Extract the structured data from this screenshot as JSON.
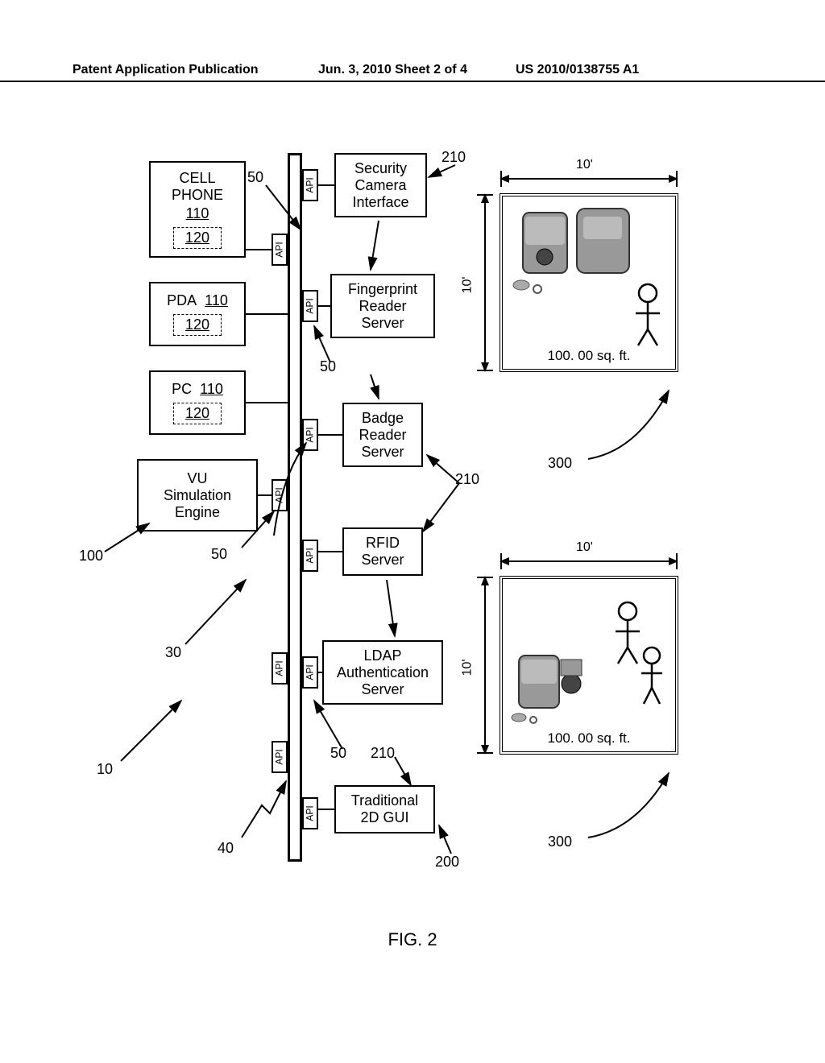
{
  "header": {
    "left": "Patent Application Publication",
    "center": "Jun. 3, 2010  Sheet 2 of 4",
    "right": "US 2010/0138755 A1"
  },
  "figure_label": "FIG. 2",
  "left_column": {
    "cellphone": {
      "line1": "CELL",
      "line2": "PHONE",
      "ref": "110",
      "sub": "120"
    },
    "pda": {
      "label": "PDA",
      "ref": "110",
      "sub": "120"
    },
    "pc": {
      "label": "PC",
      "ref": "110",
      "sub": "120"
    },
    "vu": {
      "line1": "VU",
      "line2": "Simulation",
      "line3": "Engine"
    }
  },
  "api_label": "API",
  "right_column": {
    "security": {
      "line1": "Security",
      "line2": "Camera",
      "line3": "Interface"
    },
    "fingerprint": {
      "line1": "Fingerprint",
      "line2": "Reader",
      "line3": "Server"
    },
    "badge": {
      "line1": "Badge",
      "line2": "Reader",
      "line3": "Server"
    },
    "rfid": {
      "line1": "RFID",
      "line2": "Server"
    },
    "ldap": {
      "line1": "LDAP",
      "line2": "Authentication",
      "line3": "Server"
    },
    "gui": {
      "line1": "Traditional",
      "line2": "2D GUI"
    }
  },
  "refs": {
    "r10": "10",
    "r30": "30",
    "r40": "40",
    "r50_a": "50",
    "r50_b": "50",
    "r50_c": "50",
    "r50_d": "50",
    "r100": "100",
    "r200": "200",
    "r210_a": "210",
    "r210_b": "210",
    "r210_c": "210",
    "r300_a": "300",
    "r300_b": "300"
  },
  "room": {
    "dim_w": "10'",
    "dim_h": "10'",
    "area": "100. 00 sq. ft."
  }
}
